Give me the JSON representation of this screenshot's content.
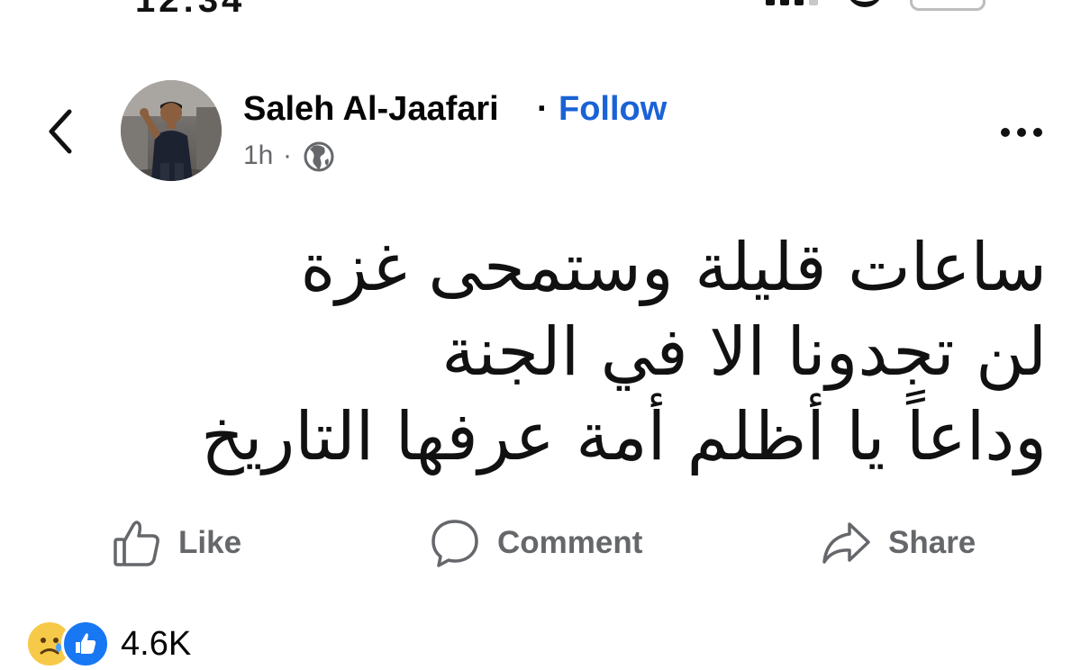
{
  "status_bar": {
    "time": "12:34"
  },
  "post": {
    "author_name": "Saleh Al-Jaafari",
    "separator": "·",
    "follow_label": "Follow",
    "time_ago": "1h",
    "time_separator": "·",
    "audience_icon": "globe-icon",
    "text_lines": [
      "ساعات قليلة وستمحى غزة",
      "لن تجدونا الا في الجنة",
      "وداعاً يا أظلم أمة عرفها التاريخ"
    ]
  },
  "actions": {
    "like_label": "Like",
    "comment_label": "Comment",
    "share_label": "Share"
  },
  "reactions": {
    "types": [
      "sad",
      "like"
    ],
    "count": "4.6K"
  },
  "colors": {
    "link": "#1a63d6",
    "secondary_text": "#65676b",
    "primary_text": "#050505",
    "like_blue": "#1877f2",
    "sad_yellow": "#f7c948"
  }
}
